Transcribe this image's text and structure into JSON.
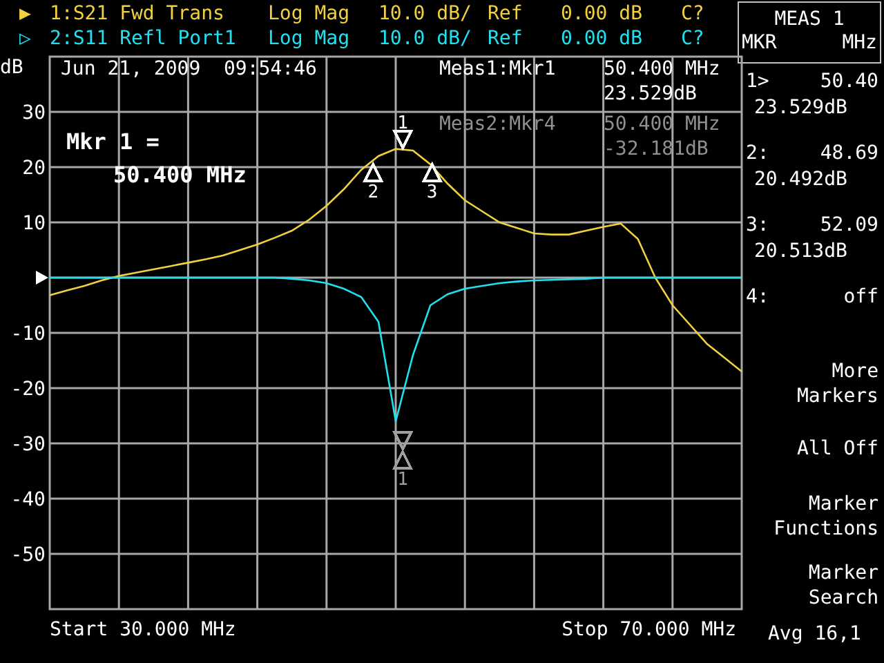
{
  "traces": [
    {
      "symbol": "▶",
      "name": "1:S21 Fwd Trans",
      "format": "Log Mag",
      "scale": "10.0 dB/",
      "ref_label": "Ref",
      "ref_value": "0.00 dB",
      "cal": "C?",
      "color": "#f0d040"
    },
    {
      "symbol": "▷",
      "name": "2:S11 Refl Port1",
      "format": "Log Mag",
      "scale": "10.0 dB/",
      "ref_label": "Ref",
      "ref_value": "0.00 dB",
      "cal": "C?",
      "color": "#20e0f0"
    }
  ],
  "plot": {
    "timestamp": "Jun 21, 2009  09:54:46",
    "readouts": [
      {
        "label": "Meas1:Mkr1",
        "freq": "50.400 MHz",
        "value": "23.529dB",
        "dim": false
      },
      {
        "label": "Meas2:Mkr4",
        "freq": "50.400 MHz",
        "value": "-32.181dB",
        "dim": true
      }
    ],
    "marker_title": "Mkr 1 =",
    "marker_value": "50.400 MHz",
    "start": "Start 30.000 MHz",
    "stop": "Stop 70.000 MHz",
    "chart_data": {
      "type": "line",
      "ylabel": "dB",
      "categories": [
        null,
        null,
        null,
        null,
        null,
        null,
        null,
        null,
        null,
        null,
        null,
        null,
        null,
        null,
        null,
        null,
        null,
        null,
        null,
        null,
        null,
        null,
        null,
        null,
        null,
        null,
        null,
        null,
        null,
        null,
        null,
        null,
        null,
        null,
        null,
        null,
        null,
        null,
        null,
        null,
        null
      ],
      "series": [
        {
          "color": "#f0d040",
          "values": [
            -3.2,
            -2.3,
            -1.5,
            -0.5,
            0.3,
            0.9,
            1.5,
            2.1,
            2.7,
            3.3,
            4,
            5,
            6,
            7.2,
            8.5,
            10.5,
            13,
            16,
            19.5,
            22,
            23.3,
            23,
            20.5,
            17,
            14,
            12,
            10,
            9,
            8,
            7.8,
            7.8,
            8.5,
            9.2,
            9.8,
            7,
            0,
            -5,
            -8.5,
            -12,
            -14.5,
            -17
          ]
        },
        {
          "color": "#20e0f0",
          "values": [
            0,
            0,
            0,
            0,
            0,
            0,
            0,
            0,
            0,
            0,
            0,
            0,
            0,
            0,
            -0.2,
            -0.5,
            -1,
            -2,
            -3.5,
            -8,
            -26,
            -14,
            -5,
            -3,
            -2,
            -1.5,
            -1,
            -0.7,
            -0.5,
            -0.4,
            -0.3,
            -0.2,
            0,
            0,
            0,
            0,
            0,
            0,
            0,
            0,
            0
          ]
        }
      ],
      "ylim": [
        -60,
        40
      ],
      "yticks": [
        30,
        20,
        10,
        -10,
        -20,
        -30,
        -40,
        -50
      ],
      "grid": true
    },
    "markers": [
      {
        "text": "1",
        "kind": "down",
        "color": "#ffffff"
      },
      {
        "text": "2",
        "kind": "up",
        "color": "#ffffff"
      },
      {
        "text": "3",
        "kind": "up",
        "color": "#ffffff"
      },
      {
        "text": "1",
        "kind": "pair",
        "color": "#a0a0a0"
      }
    ]
  },
  "panel": {
    "title": "MEAS 1",
    "col_left": "MKR",
    "col_right": "MHz",
    "markers": [
      {
        "id": "1>",
        "freq": "50.40",
        "value": "23.529dB"
      },
      {
        "id": "2:",
        "freq": "48.69",
        "value": "20.492dB"
      },
      {
        "id": "3:",
        "freq": "52.09",
        "value": "20.513dB"
      },
      {
        "id": "4:",
        "freq": "off"
      }
    ],
    "softkeys": [
      {
        "lines": [
          "More",
          "Markers"
        ]
      },
      {
        "lines": [
          "All Off"
        ]
      },
      {
        "lines": [
          "Marker",
          "Functions"
        ]
      },
      {
        "lines": [
          "Marker",
          "Search"
        ]
      }
    ],
    "status": "Avg 16,1"
  }
}
